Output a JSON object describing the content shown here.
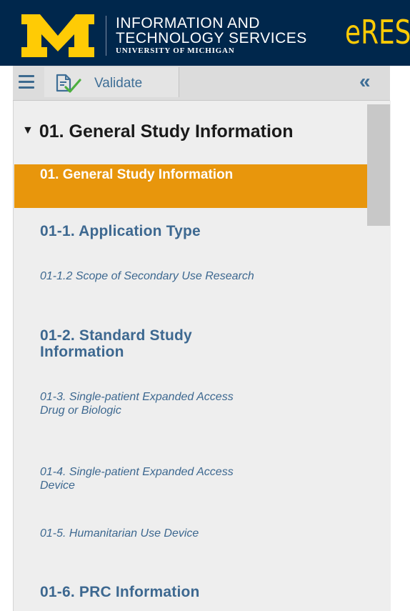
{
  "header": {
    "logo_letter": "M",
    "its_line1": "INFORMATION AND",
    "its_line2": "TECHNOLOGY SERVICES",
    "its_line3": "UNIVERSITY OF MICHIGAN",
    "product": "eRES",
    "colors": {
      "navy": "#00274c",
      "maize": "#ffcb05"
    }
  },
  "toolbar": {
    "menu_icon": "hamburger-icon",
    "validate_icon": "document-check-icon",
    "validate_label": "Validate",
    "collapse_icon": "double-chevron-left-icon",
    "collapse_symbol": "«"
  },
  "nav": {
    "section_title": "01. General Study Information",
    "section_caret": "▼",
    "active_item": {
      "label": "01. General Study Information",
      "color": "#e8960c"
    },
    "items": [
      {
        "label": "01-1. Application Type",
        "style": "bold"
      },
      {
        "label": "01-1.2 Scope of Secondary Use Research",
        "style": "italic"
      },
      {
        "label": "01-2. Standard Study Information",
        "style": "bold"
      },
      {
        "label": "01-3. Single-patient Expanded Access Drug or Biologic",
        "style": "italic"
      },
      {
        "label": "01-4. Single-patient Expanded Access Device",
        "style": "italic"
      },
      {
        "label": "01-5. Humanitarian Use Device",
        "style": "italic"
      },
      {
        "label": "01-6. PRC Information",
        "style": "bold"
      }
    ]
  }
}
